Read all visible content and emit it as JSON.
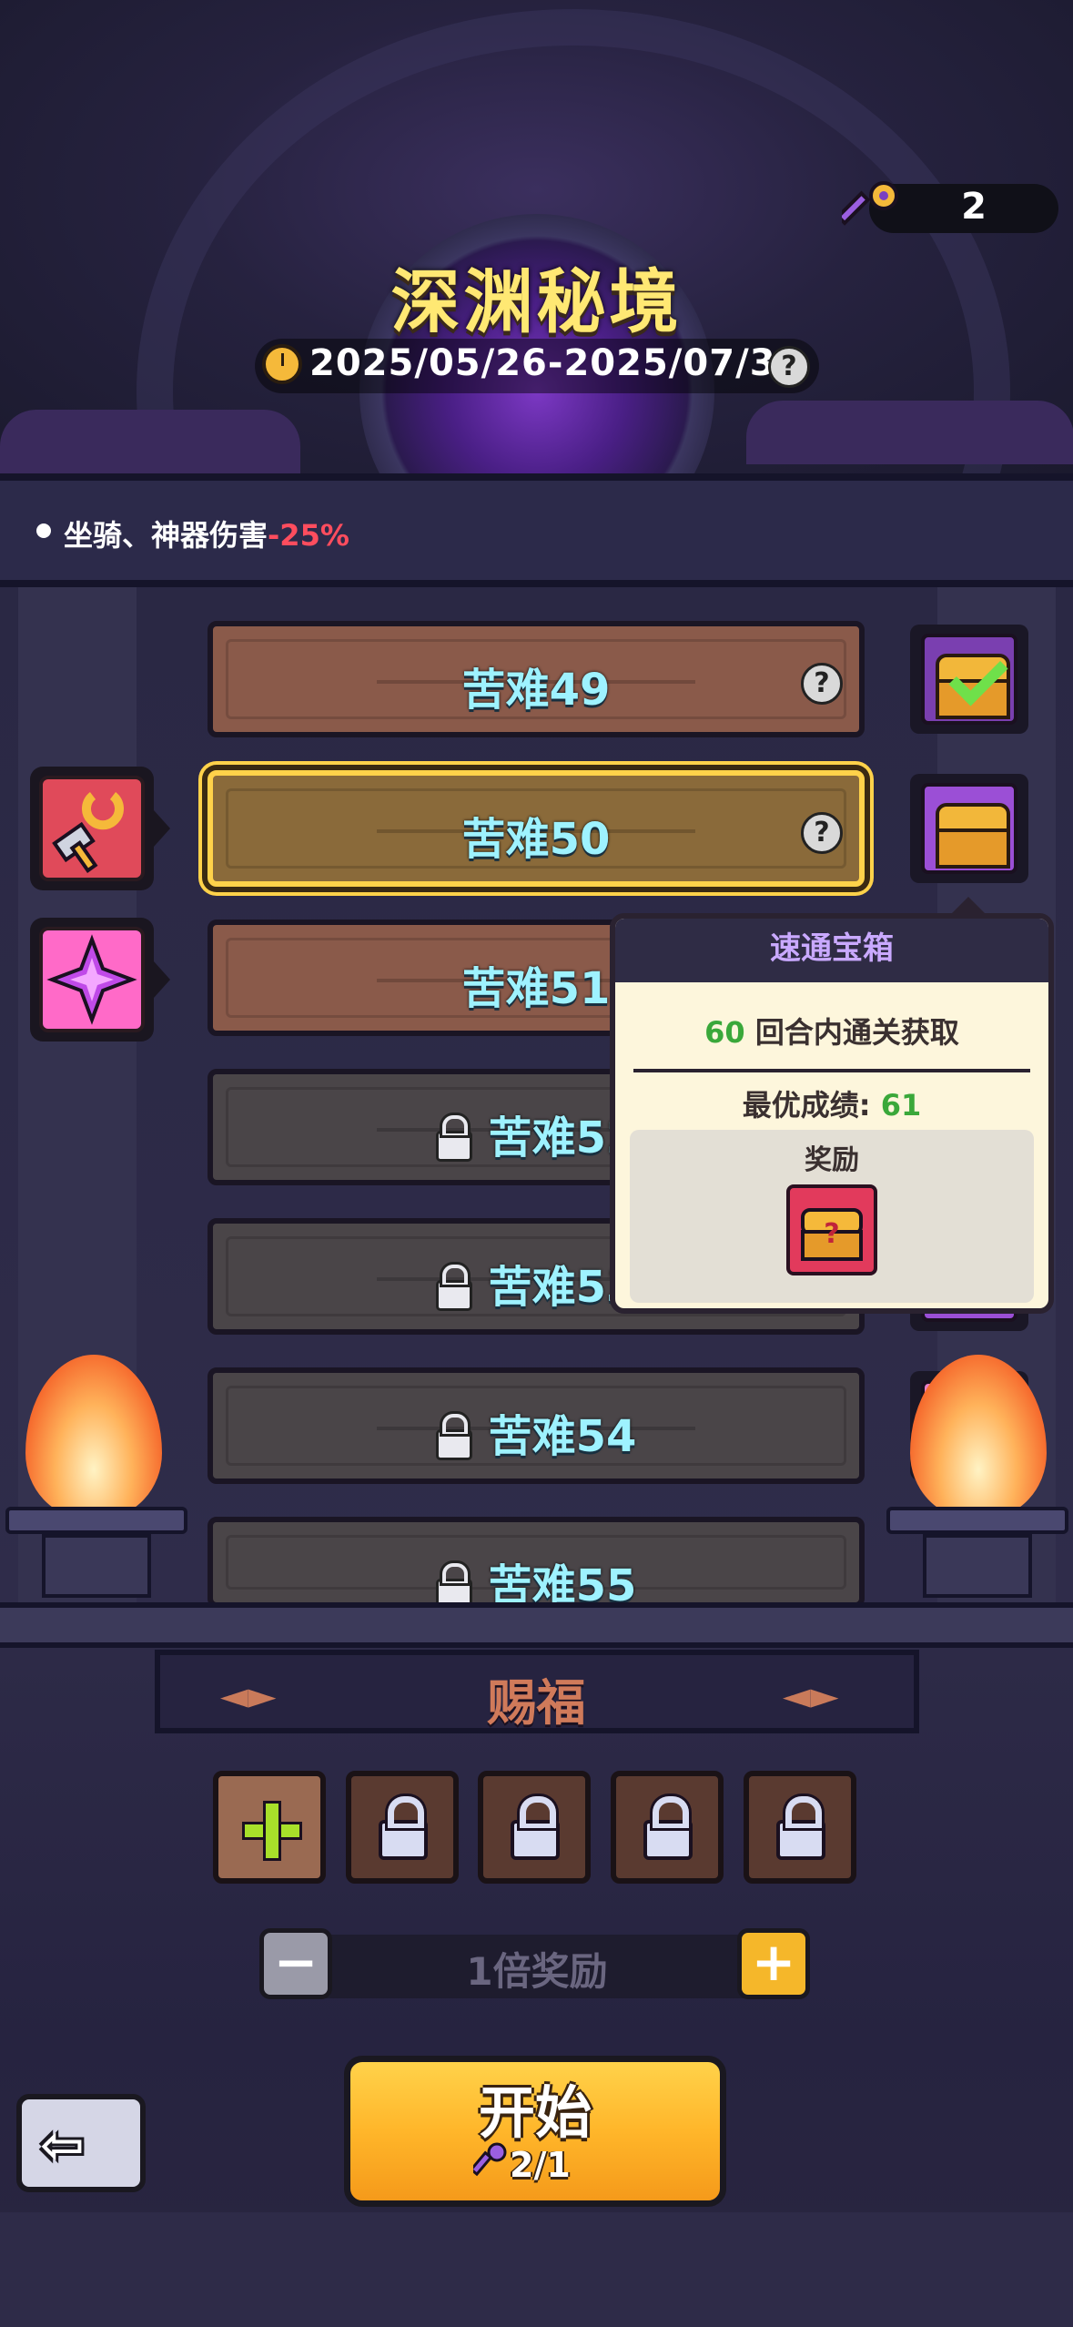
{
  "header": {
    "title": "深渊秘境",
    "date_range": "2025/05/26-2025/07/30",
    "help_icon": "?",
    "key_count": "2"
  },
  "modifier": {
    "text": "坐骑、神器伤害",
    "value": "-25%"
  },
  "levels": [
    {
      "label": "苦难49",
      "state": "open",
      "help": "?"
    },
    {
      "label": "苦难50",
      "state": "selected",
      "help": "?"
    },
    {
      "label": "苦难51",
      "state": "open"
    },
    {
      "label": "苦难52",
      "state": "locked"
    },
    {
      "label": "苦难53",
      "state": "locked"
    },
    {
      "label": "苦难54",
      "state": "locked"
    },
    {
      "label": "苦难55",
      "state": "locked"
    }
  ],
  "tooltip": {
    "title": "速通宝箱",
    "turns": "60",
    "condition": " 回合内通关获取",
    "best_label": "最优成绩: ",
    "best_value": "61",
    "reward_label": "奖励"
  },
  "blessing": {
    "title": "赐福",
    "multiplier": "1倍奖励"
  },
  "start": {
    "label": "开始",
    "cost": "2/1"
  },
  "colors": {
    "accent_gold": "#ffd24a",
    "title_yellow": "#ffe873",
    "level_text": "#9ef2ff",
    "negative": "#ff4d5e",
    "positive": "#3aa83a"
  }
}
